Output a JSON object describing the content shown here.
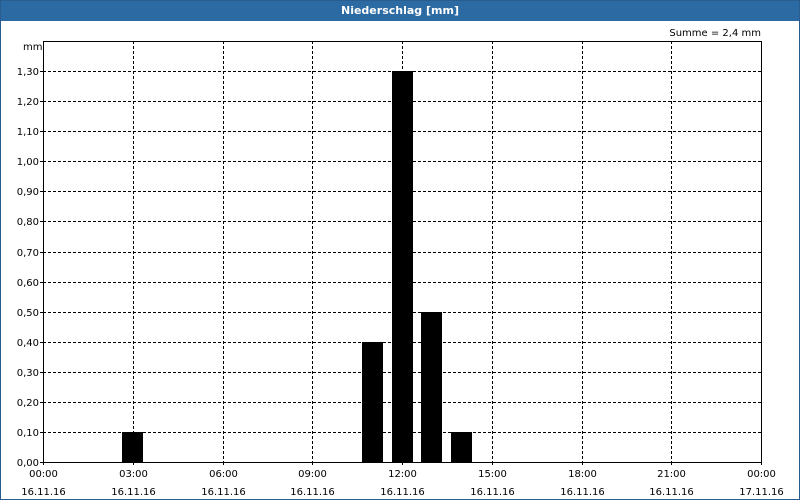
{
  "window": {
    "title": "Niederschlag [mm]"
  },
  "colors": {
    "titlebar": "#2b6aa3",
    "bar": "#000000",
    "grid": "#000000"
  },
  "chart_data": {
    "type": "bar",
    "title": "Niederschlag [mm]",
    "ylabel": "mm",
    "summary": "Summe = 2,4 mm",
    "ylim": [
      0,
      1.4
    ],
    "xlim_hours": [
      0,
      24
    ],
    "yticks": [
      {
        "value": 0.0,
        "label": "0,00"
      },
      {
        "value": 0.1,
        "label": "0,10"
      },
      {
        "value": 0.2,
        "label": "0,20"
      },
      {
        "value": 0.3,
        "label": "0,30"
      },
      {
        "value": 0.4,
        "label": "0,40"
      },
      {
        "value": 0.5,
        "label": "0,50"
      },
      {
        "value": 0.6,
        "label": "0,60"
      },
      {
        "value": 0.7,
        "label": "0,70"
      },
      {
        "value": 0.8,
        "label": "0,80"
      },
      {
        "value": 0.9,
        "label": "0,90"
      },
      {
        "value": 1.0,
        "label": "1,00"
      },
      {
        "value": 1.1,
        "label": "1,10"
      },
      {
        "value": 1.2,
        "label": "1,20"
      },
      {
        "value": 1.3,
        "label": "1,30"
      }
    ],
    "xticks": [
      {
        "hour": 0,
        "time": "00:00",
        "date": "16.11.16"
      },
      {
        "hour": 3,
        "time": "03:00",
        "date": "16.11.16"
      },
      {
        "hour": 6,
        "time": "06:00",
        "date": "16.11.16"
      },
      {
        "hour": 9,
        "time": "09:00",
        "date": "16.11.16"
      },
      {
        "hour": 12,
        "time": "12:00",
        "date": "16.11.16"
      },
      {
        "hour": 15,
        "time": "15:00",
        "date": "16.11.16"
      },
      {
        "hour": 18,
        "time": "18:00",
        "date": "16.11.16"
      },
      {
        "hour": 21,
        "time": "21:00",
        "date": "16.11.16"
      },
      {
        "hour": 24,
        "time": "00:00",
        "date": "17.11.16"
      }
    ],
    "bars": [
      {
        "hour": 3,
        "value": 0.1
      },
      {
        "hour": 11,
        "value": 0.4
      },
      {
        "hour": 12,
        "value": 1.3
      },
      {
        "hour": 13,
        "value": 0.5
      },
      {
        "hour": 14,
        "value": 0.1
      }
    ],
    "grid": true
  }
}
